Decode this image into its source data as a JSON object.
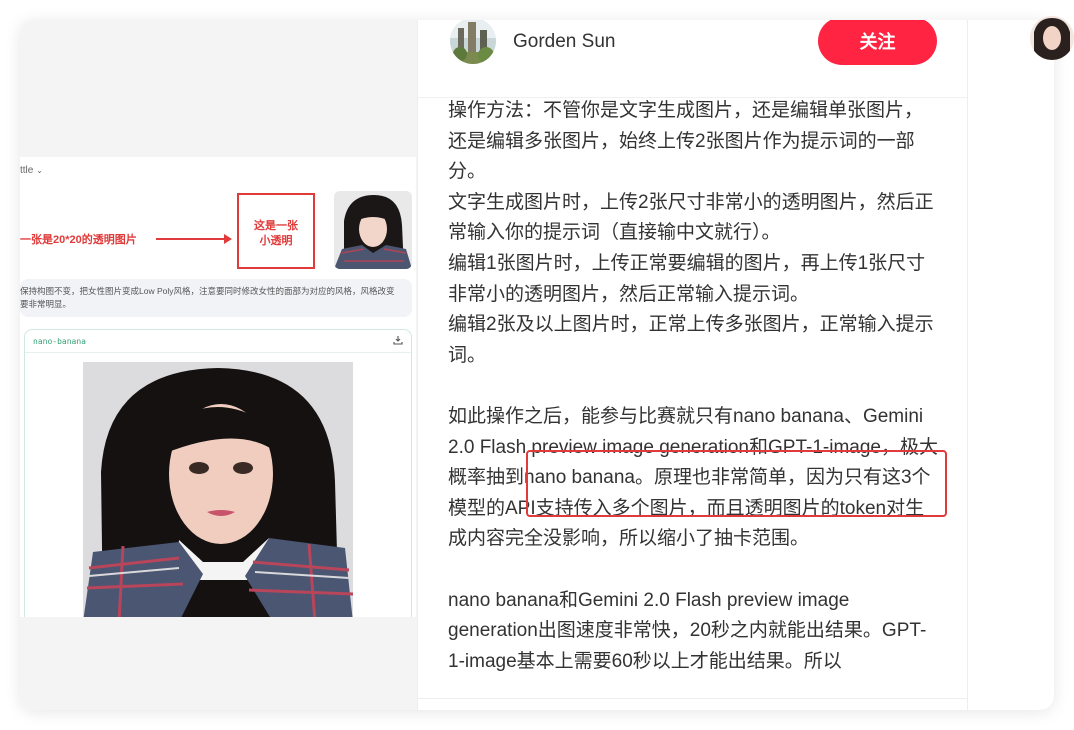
{
  "author": {
    "name": "Gorden Sun",
    "follow_label": "关注",
    "avatar_icon": "avatar-photo"
  },
  "left_screenshot": {
    "model_dropdown": "ttle",
    "annotation_text": "一张是20*20的透明图片",
    "tiny_image_label_line1": "这是一张",
    "tiny_image_label_line2": "小透明",
    "prompt_text_line1": "保持构图不变，把女性图片变成Low Poly风格，注意要同时修改女性的面部为对应的风格，风格改变",
    "prompt_text_line2": "要非常明显。",
    "result_model_tag": "nano-banana",
    "download_icon": "download-icon"
  },
  "body": {
    "paragraphs": [
      "操作方法：不管你是文字生成图片，还是编辑单张图片，还是编辑多张图片，始终上传2张图片作为提示词的一部分。",
      "文字生成图片时，上传2张尺寸非常小的透明图片，然后正常输入你的提示词（直接输中文就行）。",
      "编辑1张图片时，上传正常要编辑的图片，再上传1张尺寸非常小的透明图片，然后正常输入提示词。",
      "编辑2张及以上图片时，正常上传多张图片，正常输入提示词。",
      "",
      "如此操作之后，能参与比赛就只有nano banana、Gemini 2.0 Flash preview image generation和GPT-1-image，极大概率抽到nano banana。原理也非常简单，因为只有这3个模型的API支持传入多个图片，而且透明图片的token对生成内容完全没影响，所以缩小了抽卡范围。",
      "",
      "nano banana和Gemini 2.0 Flash preview image generation出图速度非常快，20秒之内就能出结果。GPT-1-image基本上需要60秒以上才能出结果。所以"
    ]
  },
  "colors": {
    "accent": "#ff2442",
    "highlight": "#e03a3a",
    "text": "#333333"
  }
}
